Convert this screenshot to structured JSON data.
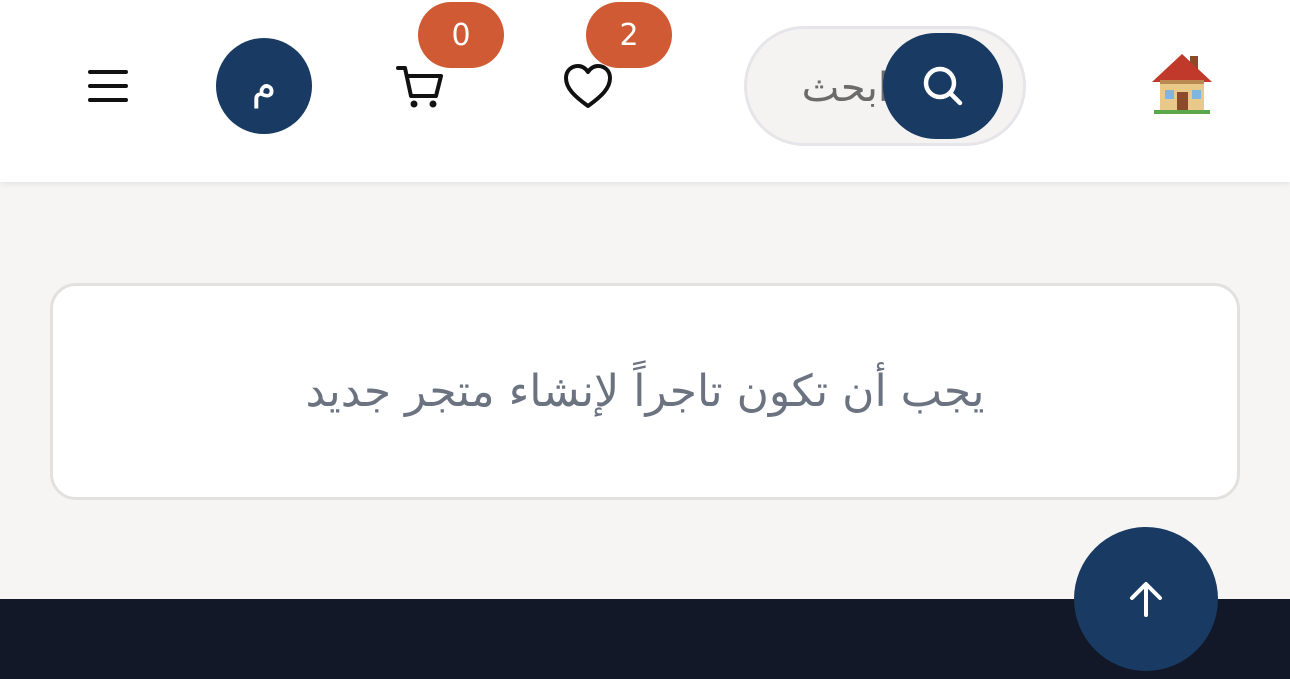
{
  "header": {
    "menu_icon": "hamburger-menu-icon",
    "avatar_letter": "م",
    "cart": {
      "icon": "cart-icon",
      "count": "0"
    },
    "wishlist": {
      "icon": "heart-icon",
      "count": "2"
    },
    "search": {
      "placeholder": "ابحث",
      "icon": "search-icon"
    },
    "logo_icon": "house-icon"
  },
  "main": {
    "message": "يجب أن تكون تاجراً لإنشاء متجر جديد"
  },
  "scroll_top": {
    "icon": "arrow-up-icon"
  },
  "colors": {
    "primary": "#183a63",
    "badge": "#d05a33",
    "footer": "#121827",
    "page_bg": "#f6f5f4"
  }
}
